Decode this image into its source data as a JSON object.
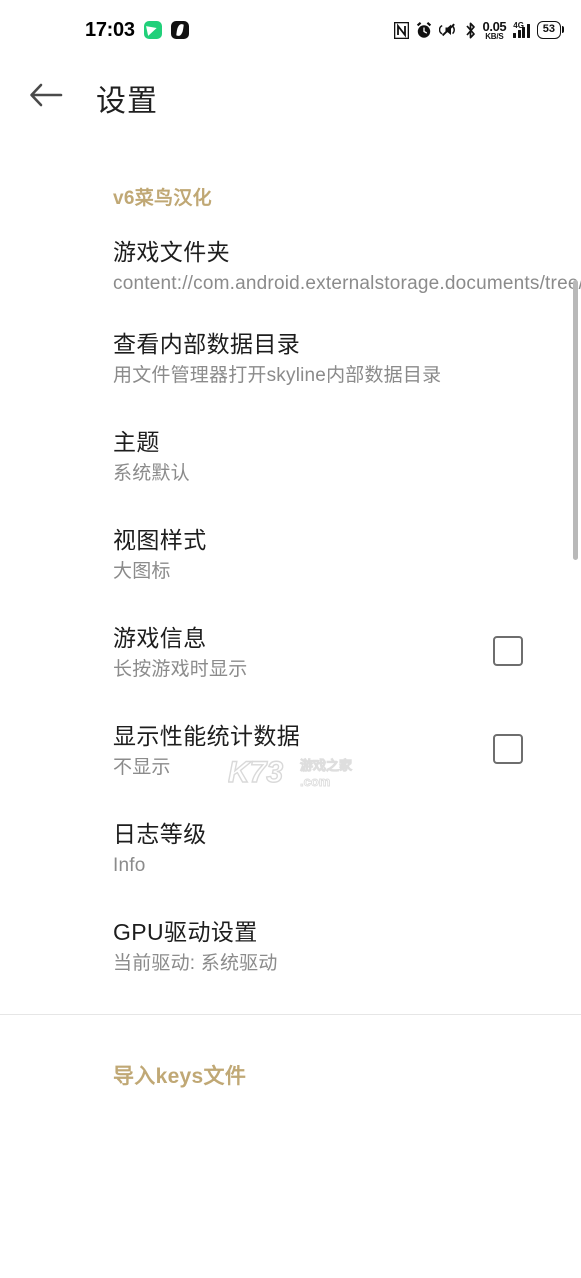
{
  "status_bar": {
    "time": "17:03",
    "left_icons": [
      "green-app-icon",
      "black-app-icon"
    ],
    "right_icons": [
      "nfc-icon",
      "alarm-icon",
      "mute-icon",
      "bluetooth-icon"
    ],
    "data_rate_value": "0.05",
    "data_rate_unit": "KB/S",
    "network_type": "4G",
    "battery_level": "53"
  },
  "app_bar": {
    "back_icon": "back-arrow-icon",
    "title": "设置"
  },
  "sections": [
    {
      "header": "v6菜鸟汉化",
      "items": [
        {
          "title": "游戏文件夹",
          "subtitle": "content://com.android.externalstorage.documents/tree/primary:DingTalk",
          "control": "none"
        },
        {
          "title": "查看内部数据目录",
          "subtitle": "用文件管理器打开skyline内部数据目录",
          "control": "none"
        },
        {
          "title": "主题",
          "subtitle": "系统默认",
          "control": "none"
        },
        {
          "title": "视图样式",
          "subtitle": "大图标",
          "control": "none"
        },
        {
          "title": "游戏信息",
          "subtitle": "长按游戏时显示",
          "control": "checkbox",
          "checked": false
        },
        {
          "title": "显示性能统计数据",
          "subtitle": "不显示",
          "control": "checkbox",
          "checked": false
        },
        {
          "title": "日志等级",
          "subtitle": "Info",
          "control": "none"
        },
        {
          "title": "GPU驱动设置",
          "subtitle": "当前驱动: 系统驱动",
          "control": "none"
        }
      ]
    }
  ],
  "footer": {
    "import_keys_label": "导入keys文件"
  },
  "watermark": {
    "logo_text": "K73",
    "brand_text": "游戏之家",
    "domain_text": ".com"
  },
  "colors": {
    "accent": "#c0a875",
    "title_text": "#1d1d1d",
    "subtitle_text": "#8b8b8b",
    "divider": "#e6e6e6",
    "scrollbar": "#b9b9b9",
    "checkbox_border": "#6e6e6e",
    "status_green": "#21d07a"
  }
}
